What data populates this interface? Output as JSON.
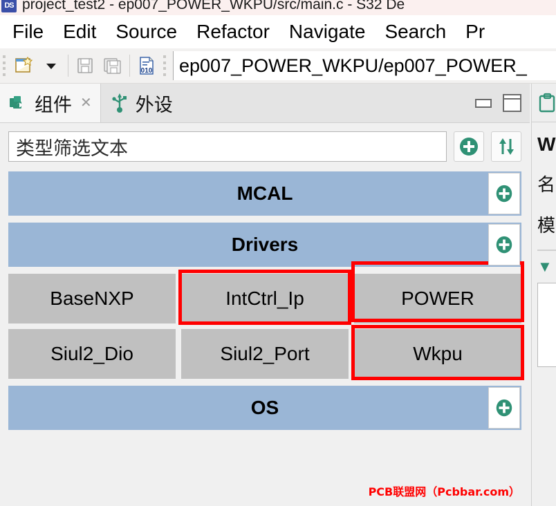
{
  "window": {
    "app_icon_label": "DS",
    "title": "project_test2 - ep007_POWER_WKPU/src/main.c - S32 De"
  },
  "menubar": {
    "items": [
      {
        "label": "File"
      },
      {
        "label": "Edit"
      },
      {
        "label": "Source"
      },
      {
        "label": "Refactor"
      },
      {
        "label": "Navigate"
      },
      {
        "label": "Search"
      },
      {
        "label": "Pr"
      }
    ]
  },
  "toolbar": {
    "new_icon": "new-file-icon",
    "dropdown_icon": "chevron-down-icon",
    "save_icon": "save-icon",
    "save_all_icon": "save-all-icon",
    "binary_icon": "binary-file-icon",
    "path_value": "ep007_POWER_WKPU/ep007_POWER_"
  },
  "left_view": {
    "tabs": [
      {
        "label": "组件",
        "icon": "components-icon",
        "active": true,
        "closable": true,
        "close_glyph": "✕"
      },
      {
        "label": "外设",
        "icon": "peripherals-usb-icon",
        "active": false,
        "closable": false
      }
    ],
    "controls": {
      "minimize": "minimize-icon",
      "maximize": "maximize-icon"
    },
    "filter": {
      "value": "类型筛选文本",
      "placeholder": "类型筛选文本",
      "add_icon": "add-plus-icon",
      "sort_icon": "sort-arrows-icon"
    },
    "tree": [
      {
        "type": "category",
        "label": "MCAL",
        "add_icon": "add-plus-icon"
      },
      {
        "type": "category",
        "label": "Drivers",
        "add_icon": "add-plus-icon"
      },
      {
        "type": "grid",
        "rows": [
          [
            {
              "label": "BaseNXP",
              "highlighted": false
            },
            {
              "label": "IntCtrl_Ip",
              "highlighted": true
            },
            {
              "label": "POWER",
              "highlighted": true,
              "highlight_up": true
            }
          ],
          [
            {
              "label": "Siul2_Dio",
              "highlighted": false
            },
            {
              "label": "Siul2_Port",
              "highlighted": false
            },
            {
              "label": "Wkpu",
              "highlighted": true
            }
          ]
        ]
      },
      {
        "type": "category",
        "label": "OS",
        "add_icon": "add-plus-icon"
      }
    ],
    "watermark": "PCB联盟网（Pcbbar.com）"
  },
  "right_panel": {
    "tab_icon": "clipboard-icon",
    "title": "W",
    "line1": "名",
    "line2": "模",
    "chevron": "▼"
  },
  "colors": {
    "category_blue": "#9ab6d6",
    "item_gray": "#c0c0c0",
    "accent_green": "#2f9175",
    "highlight_red": "#ff0000",
    "watermark_red": "#ff0000",
    "titlebar_bg": "#fbf0ef"
  }
}
